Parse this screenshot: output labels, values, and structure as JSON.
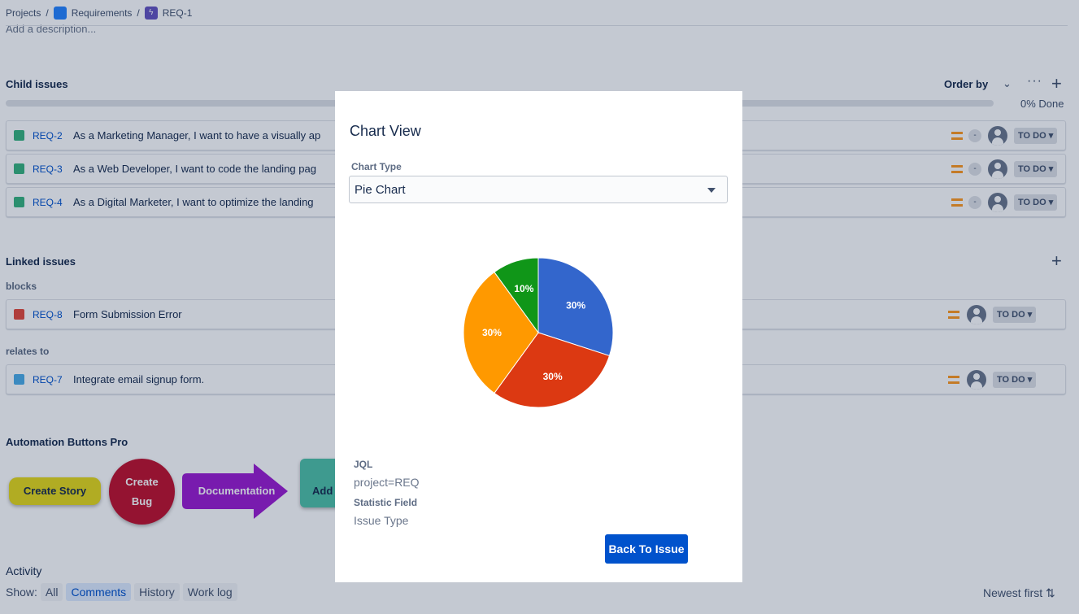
{
  "breadcrumb": {
    "projects": "Projects",
    "sep": "/",
    "project": "Requirements",
    "issue": "REQ-1"
  },
  "description_placeholder": "Add a description...",
  "child_issues": {
    "title": "Child issues",
    "order_by": "Order by",
    "more": "···",
    "add": "+",
    "progress_pct": 0,
    "progress_label": "0% Done",
    "items": [
      {
        "key": "REQ-2",
        "summary": "As a Marketing Manager, I want to have a visually ap",
        "dash": "-",
        "status": "TO DO ▾"
      },
      {
        "key": "REQ-3",
        "summary": "As a Web Developer, I want to code the landing pag",
        "dash": "-",
        "status": "TO DO ▾"
      },
      {
        "key": "REQ-4",
        "summary": "As a Digital Marketer, I want to optimize the landing",
        "dash": "-",
        "status": "TO DO ▾"
      }
    ]
  },
  "linked_issues": {
    "title": "Linked issues",
    "add": "+",
    "groups": [
      {
        "label": "blocks",
        "items": [
          {
            "key": "REQ-8",
            "summary": "Form Submission Error",
            "status": "TO DO ▾",
            "type": "bug"
          }
        ]
      },
      {
        "label": "relates to",
        "items": [
          {
            "key": "REQ-7",
            "summary": "Integrate email signup form.",
            "status": "TO DO ▾",
            "type": "task"
          }
        ]
      }
    ]
  },
  "automation": {
    "title": "Automation Buttons Pro",
    "buttons": {
      "create_story": "Create Story",
      "create_bug_line1": "Create",
      "create_bug_line2": "Bug",
      "documentation": "Documentation",
      "add": "Add"
    }
  },
  "activity": {
    "title": "Activity",
    "show": "Show:",
    "filters": [
      "All",
      "Comments",
      "History",
      "Work log"
    ],
    "active_filter": "Comments",
    "sort": "Newest first ⇅"
  },
  "modal": {
    "title": "Chart View",
    "chart_type_label": "Chart Type",
    "chart_type_value": "Pie Chart",
    "jql_label": "JQL",
    "jql_value": "project=REQ",
    "statistic_label": "Statistic Field",
    "statistic_value": "Issue Type",
    "back_button": "Back To Issue"
  },
  "chart_data": {
    "type": "pie",
    "title": "",
    "slices": [
      {
        "label": "30%",
        "value": 30,
        "color": "#3366cc"
      },
      {
        "label": "30%",
        "value": 30,
        "color": "#dc3912"
      },
      {
        "label": "30%",
        "value": 30,
        "color": "#ff9900"
      },
      {
        "label": "10%",
        "value": 10,
        "color": "#109618"
      }
    ]
  }
}
